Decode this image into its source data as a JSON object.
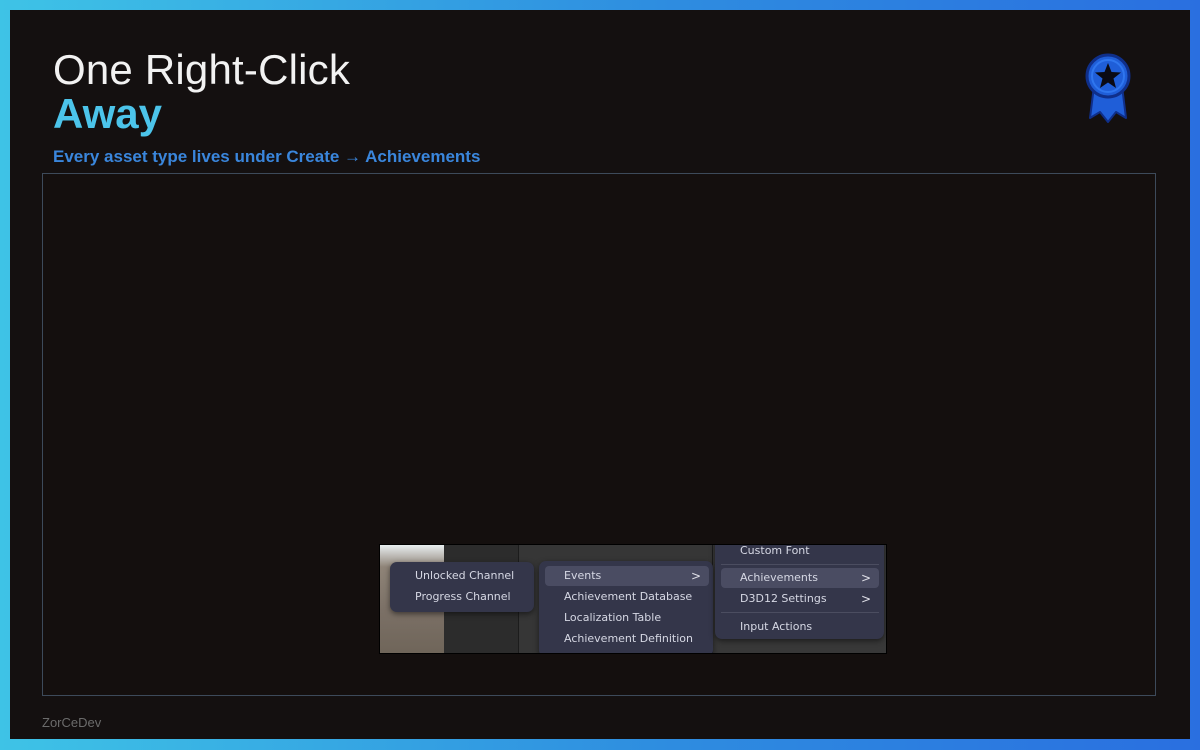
{
  "header": {
    "title_line1": "One Right-Click",
    "title_line2": "Away",
    "subtitle": "Every asset type lives under Create → Achievements",
    "icon": "award-ribbon-icon"
  },
  "footer": {
    "text": "ZorCeDev"
  },
  "context_menus": {
    "submenu_left": {
      "items": [
        {
          "label": "Unlocked Channel"
        },
        {
          "label": "Progress Channel"
        }
      ]
    },
    "submenu_middle": {
      "items": [
        {
          "label": "Events",
          "has_submenu": true,
          "chevron": ">"
        },
        {
          "label": "Achievement Database"
        },
        {
          "label": "Localization Table"
        },
        {
          "label": "Achievement Definition"
        }
      ]
    },
    "submenu_right": {
      "items": [
        {
          "label": "Custom Font"
        },
        {
          "label": "Achievements",
          "has_submenu": true,
          "chevron": ">"
        },
        {
          "label": "D3D12 Settings",
          "has_submenu": true,
          "chevron": ">"
        },
        {
          "label": "Input Actions"
        }
      ]
    }
  },
  "colors": {
    "title_white": "#f2f2f2",
    "title_accent": "#4cc4ea",
    "subtitle_blue": "#3a86dc",
    "icon_blue": "#1f5ed8",
    "menu_bg": "#34364a",
    "menu_highlight": "#4a4c62"
  }
}
